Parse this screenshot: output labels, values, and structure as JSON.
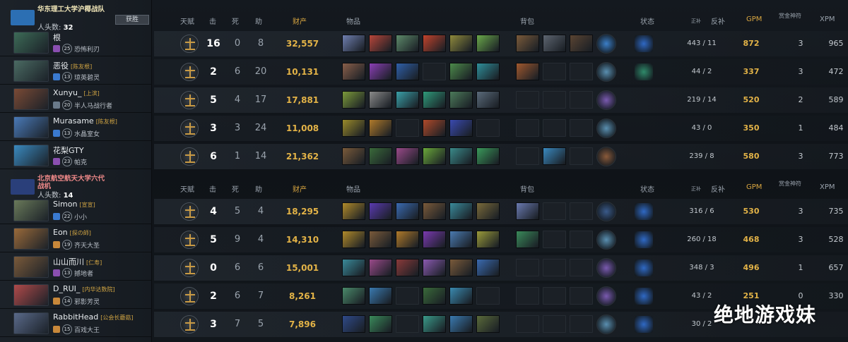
{
  "header": {
    "talent": "天赋",
    "kills": "击",
    "deaths": "死",
    "assists": "助",
    "networth": "财产",
    "items": "物品",
    "backpack": "背包",
    "status": "状态",
    "last_hits_small": "正补",
    "denies": "反补",
    "gpm": "GPM",
    "bounty": "赏金神符",
    "xpm": "XPM"
  },
  "teams": [
    {
      "name": "华东理工大学沪椰战队",
      "kills_label": "人头数:",
      "kills": "32",
      "result": "获胜",
      "logo_color": "#2c6fb3",
      "players": [
        {
          "name": "根",
          "tag": "",
          "level": "25",
          "hero": "恐怖利刃",
          "avatar_color": "#3d6b57",
          "rank_color": "#8a4fb0",
          "k": "16",
          "d": "0",
          "a": "8",
          "nw": "32,557",
          "lh": "443 / 11",
          "gpm": "872",
          "bounty": "3",
          "xpm": "965",
          "items": [
            "#6f7fb0",
            "#b8463a",
            "#5d8a6a",
            "#c2432c",
            "#8f8a3c",
            "#6aa84a"
          ],
          "backpack": [
            "#7a5a3a",
            "#5d6570",
            "#5a4432"
          ],
          "nd": "#3b7fc8",
          "status": "#2f69c4"
        },
        {
          "name": "恶役",
          "tag": "[陈友根]",
          "level": "13",
          "hero": "琼英碧灵",
          "avatar_color": "#4b6b63",
          "rank_color": "#3a7ad0",
          "k": "2",
          "d": "6",
          "a": "20",
          "nw": "10,131",
          "lh": "44 / 2",
          "gpm": "337",
          "bounty": "3",
          "xpm": "472",
          "items": [
            "#8a5f4a",
            "#8b3fb5",
            "#2f5fa8",
            "",
            "#4c8a4a",
            "#2f8f9a"
          ],
          "backpack": [
            "#a0582e",
            "",
            ""
          ],
          "nd": "#5a8fb0",
          "status": "#2f8a6a"
        },
        {
          "name": "Xunyu_",
          "tag": "[上滨]",
          "level": "20",
          "hero": "半人马战行者",
          "avatar_color": "#7a4a35",
          "rank_color": "#6a7a8a",
          "k": "5",
          "d": "4",
          "a": "17",
          "nw": "17,881",
          "lh": "219 / 14",
          "gpm": "520",
          "bounty": "2",
          "xpm": "589",
          "items": [
            "#7c9a3a",
            "#8a8a8a",
            "#3aa0a8",
            "#2f9a7a",
            "#4c7a5a",
            "#5a6a7a"
          ],
          "backpack": [
            "",
            "",
            ""
          ],
          "nd": "#7a5ab0",
          "status": ""
        },
        {
          "name": "Murasame",
          "tag": "[陈友根]",
          "level": "13",
          "hero": "水晶室女",
          "avatar_color": "#4a7ab8",
          "rank_color": "#3a7ad0",
          "k": "3",
          "d": "3",
          "a": "24",
          "nw": "11,008",
          "lh": "43 / 0",
          "gpm": "350",
          "bounty": "1",
          "xpm": "484",
          "items": [
            "#9a8a2a",
            "#b07a2a",
            "",
            "#b04a2a",
            "#3a4ab0",
            ""
          ],
          "backpack": [
            "",
            "",
            ""
          ],
          "nd": "#5a8fb0",
          "status": ""
        },
        {
          "name": "花梨GTY",
          "tag": "",
          "level": "23",
          "hero": "帕克",
          "avatar_color": "#3a8ac0",
          "rank_color": "#8a4fb0",
          "k": "6",
          "d": "1",
          "a": "14",
          "nw": "21,362",
          "lh": "239 / 8",
          "gpm": "580",
          "bounty": "3",
          "xpm": "773",
          "items": [
            "#7a5a3a",
            "#3a6a3a",
            "#9a4a8a",
            "#6aa83a",
            "#3a8a8a",
            "#3a9a5a"
          ],
          "backpack": [
            "",
            "#3a8ac0",
            ""
          ],
          "nd": "#8a5a3a",
          "status": ""
        }
      ]
    },
    {
      "name": "北京航空航天大学六代战机",
      "kills_label": "人头数:",
      "kills": "14",
      "result": "",
      "logo_color": "#2a3f7a",
      "players": [
        {
          "name": "Simon",
          "tag": "[宣宣]",
          "level": "22",
          "hero": "小小",
          "avatar_color": "#6a7a5a",
          "rank_color": "#3a7ad0",
          "k": "4",
          "d": "5",
          "a": "4",
          "nw": "18,295",
          "lh": "316 / 6",
          "gpm": "530",
          "bounty": "3",
          "xpm": "735",
          "items": [
            "#b08a2a",
            "#5a3ab0",
            "#3a6ab0",
            "#7a5a3a",
            "#3a8a9a",
            "#7a6a3a"
          ],
          "backpack": [
            "#6a7ab0",
            "",
            ""
          ],
          "nd": "#3a5a8a",
          "status": "#2f69c4"
        },
        {
          "name": "Eon",
          "tag": "[探の師]",
          "level": "19",
          "hero": "齐天大圣",
          "avatar_color": "#9a6a3a",
          "rank_color": "#c8883a",
          "k": "5",
          "d": "9",
          "a": "4",
          "nw": "14,310",
          "lh": "260 / 18",
          "gpm": "468",
          "bounty": "3",
          "xpm": "528",
          "items": [
            "#b08a2a",
            "#7a5a3a",
            "#b07a2a",
            "#7a3ab0",
            "#4a7ab0",
            "#9a9a3a"
          ],
          "backpack": [
            "#3a8a5a",
            "",
            ""
          ],
          "nd": "#5a8fb0",
          "status": "#2f69c4"
        },
        {
          "name": "山山而川",
          "tag": "[仁寿]",
          "level": "13",
          "hero": "撼地者",
          "avatar_color": "#7a5a3a",
          "rank_color": "#8a4fb0",
          "k": "0",
          "d": "6",
          "a": "6",
          "nw": "15,001",
          "lh": "348 / 3",
          "gpm": "496",
          "bounty": "1",
          "xpm": "657",
          "items": [
            "#3a8a9a",
            "#9a4a8a",
            "#8a3a3a",
            "#8a5ab0",
            "#7a5a3a",
            "#3a6ab0"
          ],
          "backpack": [
            "",
            "",
            ""
          ],
          "nd": "#7a5ab0",
          "status": "#2f69c4"
        },
        {
          "name": "D_RUI_",
          "tag": "[内华达数院]",
          "level": "14",
          "hero": "邪影芳灵",
          "avatar_color": "#b04a4a",
          "rank_color": "#c8883a",
          "k": "2",
          "d": "6",
          "a": "7",
          "nw": "8,261",
          "lh": "43 / 2",
          "gpm": "251",
          "bounty": "0",
          "xpm": "330",
          "items": [
            "#4a8a6a",
            "#3a7ab0",
            "",
            "#3a6a3a",
            "#3a8ab0",
            ""
          ],
          "backpack": [
            "",
            "",
            ""
          ],
          "nd": "#7a5ab0",
          "status": "#2f69c4"
        },
        {
          "name": "RabbitHead",
          "tag": "[公会长蘑菇]",
          "level": "15",
          "hero": "百戏大王",
          "avatar_color": "#5a6a8a",
          "rank_color": "#c8883a",
          "k": "3",
          "d": "7",
          "a": "5",
          "nw": "7,896",
          "lh": "30 / 2",
          "gpm": "",
          "bounty": "",
          "xpm": "",
          "items": [
            "#2f4a8a",
            "#3a8a5a",
            "",
            "#3a9a8a",
            "#3a7ab0",
            "#5a6a3a"
          ],
          "backpack": [
            "",
            "",
            ""
          ],
          "nd": "#5a8fb0",
          "status": "#2f69c4"
        }
      ]
    }
  ],
  "watermark": "绝地游戏妹"
}
